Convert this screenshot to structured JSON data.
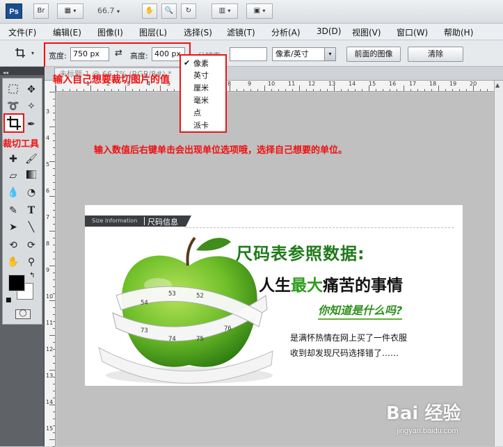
{
  "app": {
    "logo": "Ps",
    "bridge_label": "Br",
    "zoom": "66.7",
    "caret": "▾"
  },
  "menu": [
    "文件(F)",
    "编辑(E)",
    "图像(I)",
    "图层(L)",
    "选择(S)",
    "滤镜(T)",
    "分析(A)",
    "3D(D)",
    "视图(V)",
    "窗口(W)",
    "帮助(H)"
  ],
  "options": {
    "width_label": "宽度:",
    "width_value": "750 px",
    "height_label": "高度:",
    "height_value": "400 px",
    "resolution_label": "分辨率:",
    "resolution_value": "",
    "unit_select": "像素/英寸",
    "front_image_button": "前面的图像",
    "clear_button": "清除"
  },
  "unit_menu": {
    "check": "✔",
    "items": [
      "像素",
      "英寸",
      "厘米",
      "毫米",
      "点",
      "派卡"
    ]
  },
  "document": {
    "tab_title": "未标题-1 @ 66.7% (RGB/8#) *",
    "close": "✕",
    "ruler_numbers": [
      "3",
      "1",
      "2",
      "3",
      "4",
      "5",
      "6",
      "7",
      "8",
      "9",
      "10",
      "11",
      "12",
      "13",
      "14",
      "15",
      "16",
      "17",
      "18",
      "19",
      "20"
    ]
  },
  "tools": {
    "crop_label": "裁切工具"
  },
  "annotations": {
    "top": "输入自己想要裁切图片的值",
    "middle": "输入数值后右键单击会出现单位选项哦，选择自己想要的单位。"
  },
  "image": {
    "band_en": "Size Information",
    "band_cn": "尺码信息",
    "headline1": "尺码表参照数据:",
    "headline2_a": "人生",
    "headline2_b": "最大",
    "headline2_c": "痛苦的事情",
    "headline3": "你知道是什么吗?",
    "body1": "是满怀热情在网上买了一件衣服",
    "body2": "收到却发现尺码选择错了……"
  },
  "watermark": {
    "brand": "Bai 经验",
    "url": "jingyan.baidu.com"
  },
  "colors": {
    "annotation_red": "#e11111",
    "apple_green": "#6fbf2a",
    "headline_green": "#1f7a1a"
  }
}
